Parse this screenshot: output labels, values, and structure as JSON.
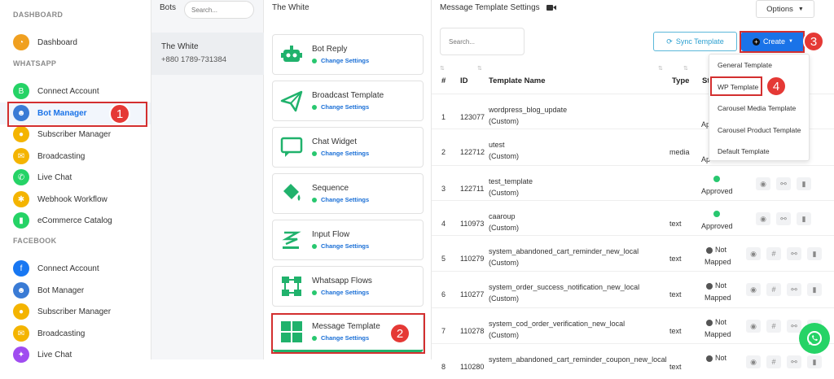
{
  "sidebar": {
    "sections": [
      {
        "label": "DASHBOARD",
        "items": [
          {
            "label": "Dashboard",
            "icon": "gauge-icon",
            "color": "#f0a020"
          }
        ]
      },
      {
        "label": "WHATSAPP",
        "items": [
          {
            "label": "Connect Account",
            "icon": "whatsapp-business-icon",
            "color": "#25d366"
          },
          {
            "label": "Bot Manager",
            "icon": "robot-icon",
            "color": "#3a7bd5",
            "active": true
          },
          {
            "label": "Subscriber Manager",
            "icon": "users-icon",
            "color": "#f4b400"
          },
          {
            "label": "Broadcasting",
            "icon": "megaphone-icon",
            "color": "#f4b400"
          },
          {
            "label": "Live Chat",
            "icon": "whatsapp-icon",
            "color": "#25d366"
          },
          {
            "label": "Webhook Workflow",
            "icon": "webhook-icon",
            "color": "#f4b400"
          },
          {
            "label": "eCommerce Catalog",
            "icon": "catalog-icon",
            "color": "#25d366"
          }
        ]
      },
      {
        "label": "FACEBOOK",
        "items": [
          {
            "label": "Connect Account",
            "icon": "facebook-icon",
            "color": "#1877f2"
          },
          {
            "label": "Bot Manager",
            "icon": "robot-icon",
            "color": "#3a7bd5"
          },
          {
            "label": "Subscriber Manager",
            "icon": "users-icon",
            "color": "#f4b400"
          },
          {
            "label": "Broadcasting",
            "icon": "megaphone-icon",
            "color": "#f4b400"
          },
          {
            "label": "Live Chat",
            "icon": "messenger-icon",
            "color": "#a04cf0"
          }
        ]
      }
    ]
  },
  "bots": {
    "title": "Bots",
    "search_placeholder": "Search...",
    "selected": {
      "name": "The White",
      "phone": "+880 1789-731384"
    }
  },
  "settings": {
    "title": "The White",
    "change_label": "Change Settings",
    "cards": [
      {
        "label": "Bot Reply",
        "icon": "robot-icon"
      },
      {
        "label": "Broadcast Template",
        "icon": "paper-plane-icon"
      },
      {
        "label": "Chat Widget",
        "icon": "chat-bubble-icon"
      },
      {
        "label": "Sequence",
        "icon": "paint-bucket-icon"
      },
      {
        "label": "Input Flow",
        "icon": "stack-icon"
      },
      {
        "label": "Whatsapp Flows",
        "icon": "flow-diagram-icon"
      },
      {
        "label": "Message Template",
        "icon": "grid-icon"
      }
    ]
  },
  "main": {
    "title": "Message Template Settings",
    "options_label": "Options",
    "search_placeholder": "Search...",
    "sync_label": "Sync Template",
    "create_label": "Create",
    "headers": {
      "num": "#",
      "id": "ID",
      "name": "Template Name",
      "type": "Type",
      "status": "St"
    },
    "rows": [
      {
        "num": "1",
        "id": "123077",
        "name": "wordpress_blog_update",
        "sub": "(Custom)",
        "type": "",
        "status": "Ap",
        "dot": "",
        "actions": 0
      },
      {
        "num": "2",
        "id": "122712",
        "name": "utest",
        "sub": "(Custom)",
        "type": "media",
        "status": "Ap",
        "dot": "",
        "actions": 0
      },
      {
        "num": "3",
        "id": "122711",
        "name": "test_template",
        "sub": "(Custom)",
        "type": "",
        "status": "Approved",
        "dot": "#28c76f",
        "actions": 3
      },
      {
        "num": "4",
        "id": "110973",
        "name": "caaroup",
        "sub": "(Custom)",
        "type": "text",
        "status": "Approved",
        "dot": "#28c76f",
        "actions": 3
      },
      {
        "num": "5",
        "id": "110279",
        "name": "system_abandoned_cart_reminder_new_local",
        "sub": "(Custom)",
        "type": "text",
        "status": "Not",
        "status2": "Mapped",
        "dot": "#555",
        "actions": 4
      },
      {
        "num": "6",
        "id": "110277",
        "name": "system_order_success_notification_new_local",
        "sub": "(Custom)",
        "type": "text",
        "status": "Not",
        "status2": "Mapped",
        "dot": "#555",
        "actions": 4
      },
      {
        "num": "7",
        "id": "110278",
        "name": "system_cod_order_verification_new_local",
        "sub": "(Custom)",
        "type": "text",
        "status": "Not",
        "status2": "Mapped",
        "dot": "#555",
        "actions": 4
      },
      {
        "num": "8",
        "id": "110280",
        "name": "system_abandoned_cart_reminder_coupon_new_local",
        "sub": "",
        "type": "text",
        "status": "Not",
        "status2": "",
        "dot": "#555",
        "actions": 4
      }
    ],
    "dropdown": [
      "General Template",
      "WP Template",
      "Carousel Media Template",
      "Carousel Product Template",
      "Default Template"
    ]
  },
  "callouts": [
    "1",
    "2",
    "3",
    "4"
  ]
}
